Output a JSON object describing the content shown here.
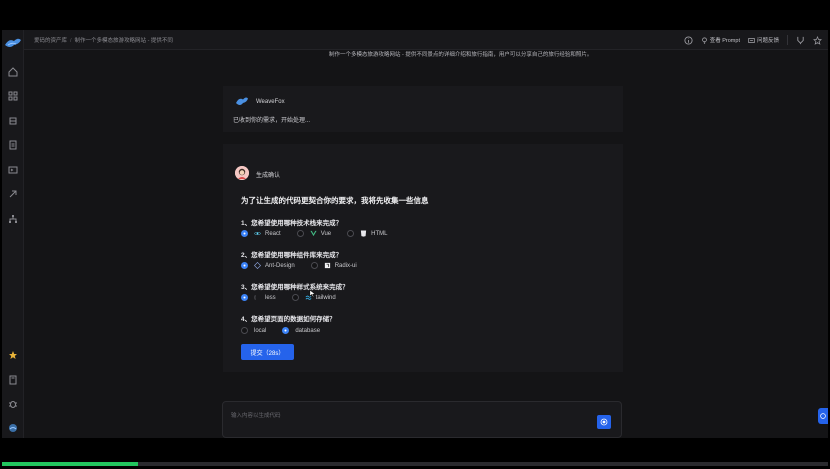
{
  "topbar": {
    "crumb_home": "爱码的资产库",
    "crumb_page": "制作一个多模态旅游攻略网站 - 提供不同",
    "view_prompt": "查看 Prompt",
    "feedback": "问题反馈"
  },
  "chat": {
    "prev_user_text": "制作一个多模态旅游攻略网站 - 提供不同景点的详细介绍和旅行指南，用户可以分享自己的旅行经验和照片。",
    "bot_name": "WeaveFox",
    "bot_msg": "已收到你的需求，开始处理...",
    "confirm_label": "生成确认",
    "form_title": "为了让生成的代码更契合你的要求，我将先收集一些信息",
    "questions": [
      {
        "label": "1、您希望使用哪种技术栈来完成？",
        "options": [
          {
            "label": "React",
            "selected": true,
            "icon": "react-icon"
          },
          {
            "label": "Vue",
            "selected": false,
            "icon": "vue-icon"
          },
          {
            "label": "HTML",
            "selected": false,
            "icon": "html-icon"
          }
        ]
      },
      {
        "label": "2、您希望使用哪种组件库来完成？",
        "options": [
          {
            "label": "Ant-Design",
            "selected": true,
            "icon": "antd-icon"
          },
          {
            "label": "Radix-ui",
            "selected": false,
            "icon": "radix-icon"
          }
        ]
      },
      {
        "label": "3、您希望使用哪种样式系统来完成？",
        "options": [
          {
            "label": "less",
            "selected": true,
            "icon": "less-icon"
          },
          {
            "label": "tailwind",
            "selected": false,
            "icon": "tailwind-icon"
          }
        ]
      },
      {
        "label": "4、您希望页面的数据如何存储？",
        "options": [
          {
            "label": "local",
            "selected": false,
            "icon": ""
          },
          {
            "label": "database",
            "selected": true,
            "icon": ""
          }
        ]
      }
    ],
    "submit_label": "提交（28s）"
  },
  "input": {
    "placeholder": "输入内容以生成代码"
  },
  "progress": {
    "fraction": 0.165
  },
  "colors": {
    "accent": "#2563eb",
    "progress": "#22c55e"
  }
}
